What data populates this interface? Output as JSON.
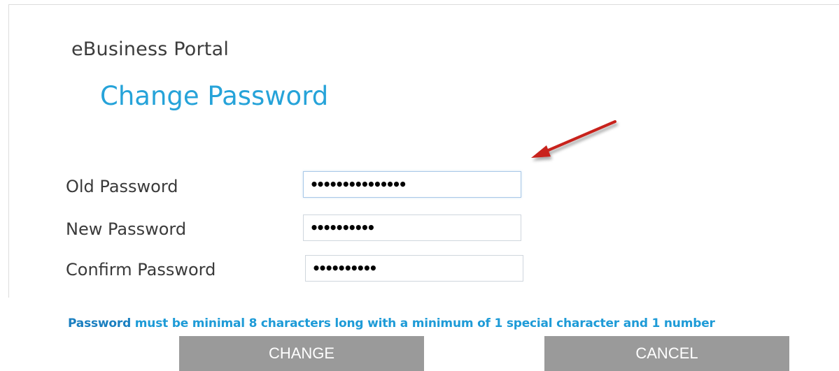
{
  "header": {
    "portal_title": "eBusiness Portal",
    "page_title": "Change Password"
  },
  "form": {
    "old_password": {
      "label": "Old Password",
      "value": "passwordvalue12"
    },
    "new_password": {
      "label": "New Password",
      "value": "newpass123"
    },
    "confirm_password": {
      "label": "Confirm Password",
      "value": "newpass123"
    }
  },
  "rules": {
    "keyword": "Password",
    "text": " must be minimal 8 characters long with a minimum of 1 special character and 1 number"
  },
  "buttons": {
    "change_label": "CHANGE",
    "cancel_label": "CANCEL"
  },
  "colors": {
    "title_blue": "#26a3d9",
    "rule_blue": "#1e9bd7",
    "button_gray": "#9a9a9a",
    "arrow_red": "#c8211d"
  }
}
